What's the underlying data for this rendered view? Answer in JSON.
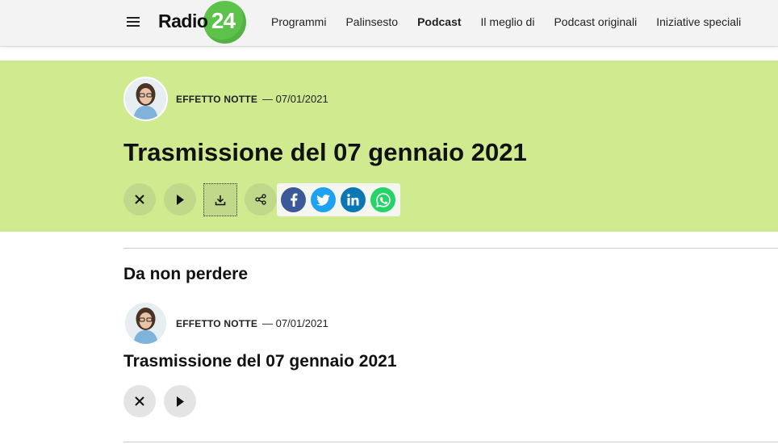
{
  "header": {
    "logo_text": "Radio",
    "logo_number": "24",
    "nav": [
      {
        "label": "Programmi",
        "active": false
      },
      {
        "label": "Palinsesto",
        "active": false
      },
      {
        "label": "Podcast",
        "active": true
      },
      {
        "label": "Il meglio di",
        "active": false
      },
      {
        "label": "Podcast originali",
        "active": false
      },
      {
        "label": "Iniziative speciali",
        "active": false
      }
    ]
  },
  "episode": {
    "program": "EFFETTO NOTTE",
    "date": "— 07/01/2021",
    "title": "Trasmissione del 07 gennaio 2021"
  },
  "controls": {
    "close_icon": "close-icon",
    "play_icon": "play-icon",
    "download_icon": "download-icon",
    "share_icon": "share-icon",
    "social": [
      "facebook-icon",
      "twitter-icon",
      "linkedin-icon",
      "whatsapp-icon"
    ]
  },
  "section": {
    "title": "Da non perdere",
    "card": {
      "program": "EFFETTO NOTTE",
      "date": "— 07/01/2021",
      "title": "Trasmissione del 07 gennaio 2021"
    }
  },
  "colors": {
    "hero_bg": "#d0ea90",
    "logo_green": "#5cc24a",
    "facebook": "#3b5998",
    "twitter": "#1da1f2",
    "linkedin": "#0a77b5",
    "whatsapp": "#25d366"
  }
}
